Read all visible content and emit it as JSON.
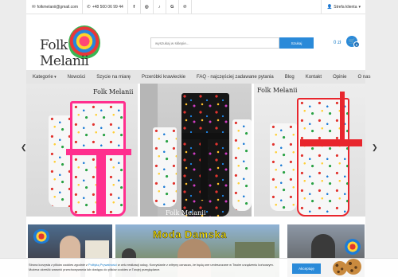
{
  "topbar": {
    "email": "folkmelanii@gmail.com",
    "phone": "+48 500 06 99 44",
    "social_icons": [
      "facebook-icon",
      "instagram-icon",
      "tiktok-icon",
      "google-icon",
      "pinterest-icon"
    ],
    "social_glyphs": [
      "f",
      "◎",
      "♪",
      "G",
      "℗"
    ],
    "account_label": "Strefa klienta"
  },
  "header": {
    "logo_text": "Folk Melanii",
    "search_placeholder": "wyszukaj w sklepie...",
    "search_button": "Szukaj",
    "cart_total": "0 zł",
    "cart_count": "0"
  },
  "nav": {
    "items": [
      "Kategorie",
      "Nowości",
      "Szycie na miarę",
      "Przeróbki krawieckie",
      "FAQ - najczęściej zadawane pytania",
      "Blog",
      "Kontakt",
      "Opinie",
      "O nas"
    ]
  },
  "slider": {
    "slide_logo": "Folk Melanii",
    "prev": "❮",
    "next": "❯"
  },
  "banners": {
    "middle_title": "Moda Damska"
  },
  "cookie": {
    "text_before": "Strona korzysta z plików cookies zgodnie z ",
    "policy_link": "Polityką Prywatności",
    "text_after": " w celu realizacji usług. Korzystanie z witryny oznacza, że będą one umieszczane w Twoim urządzeniu końcowym. Możesz określić warunki przechowywania lub dostępu do plików cookies w Twojej przeglądarce.",
    "accept_label": "Akceptuję"
  },
  "colors": {
    "accent": "#2a8ad9",
    "nav_bg": "#e5e5e5",
    "page_bg": "#ececec",
    "banner_title": "#ffe600"
  }
}
